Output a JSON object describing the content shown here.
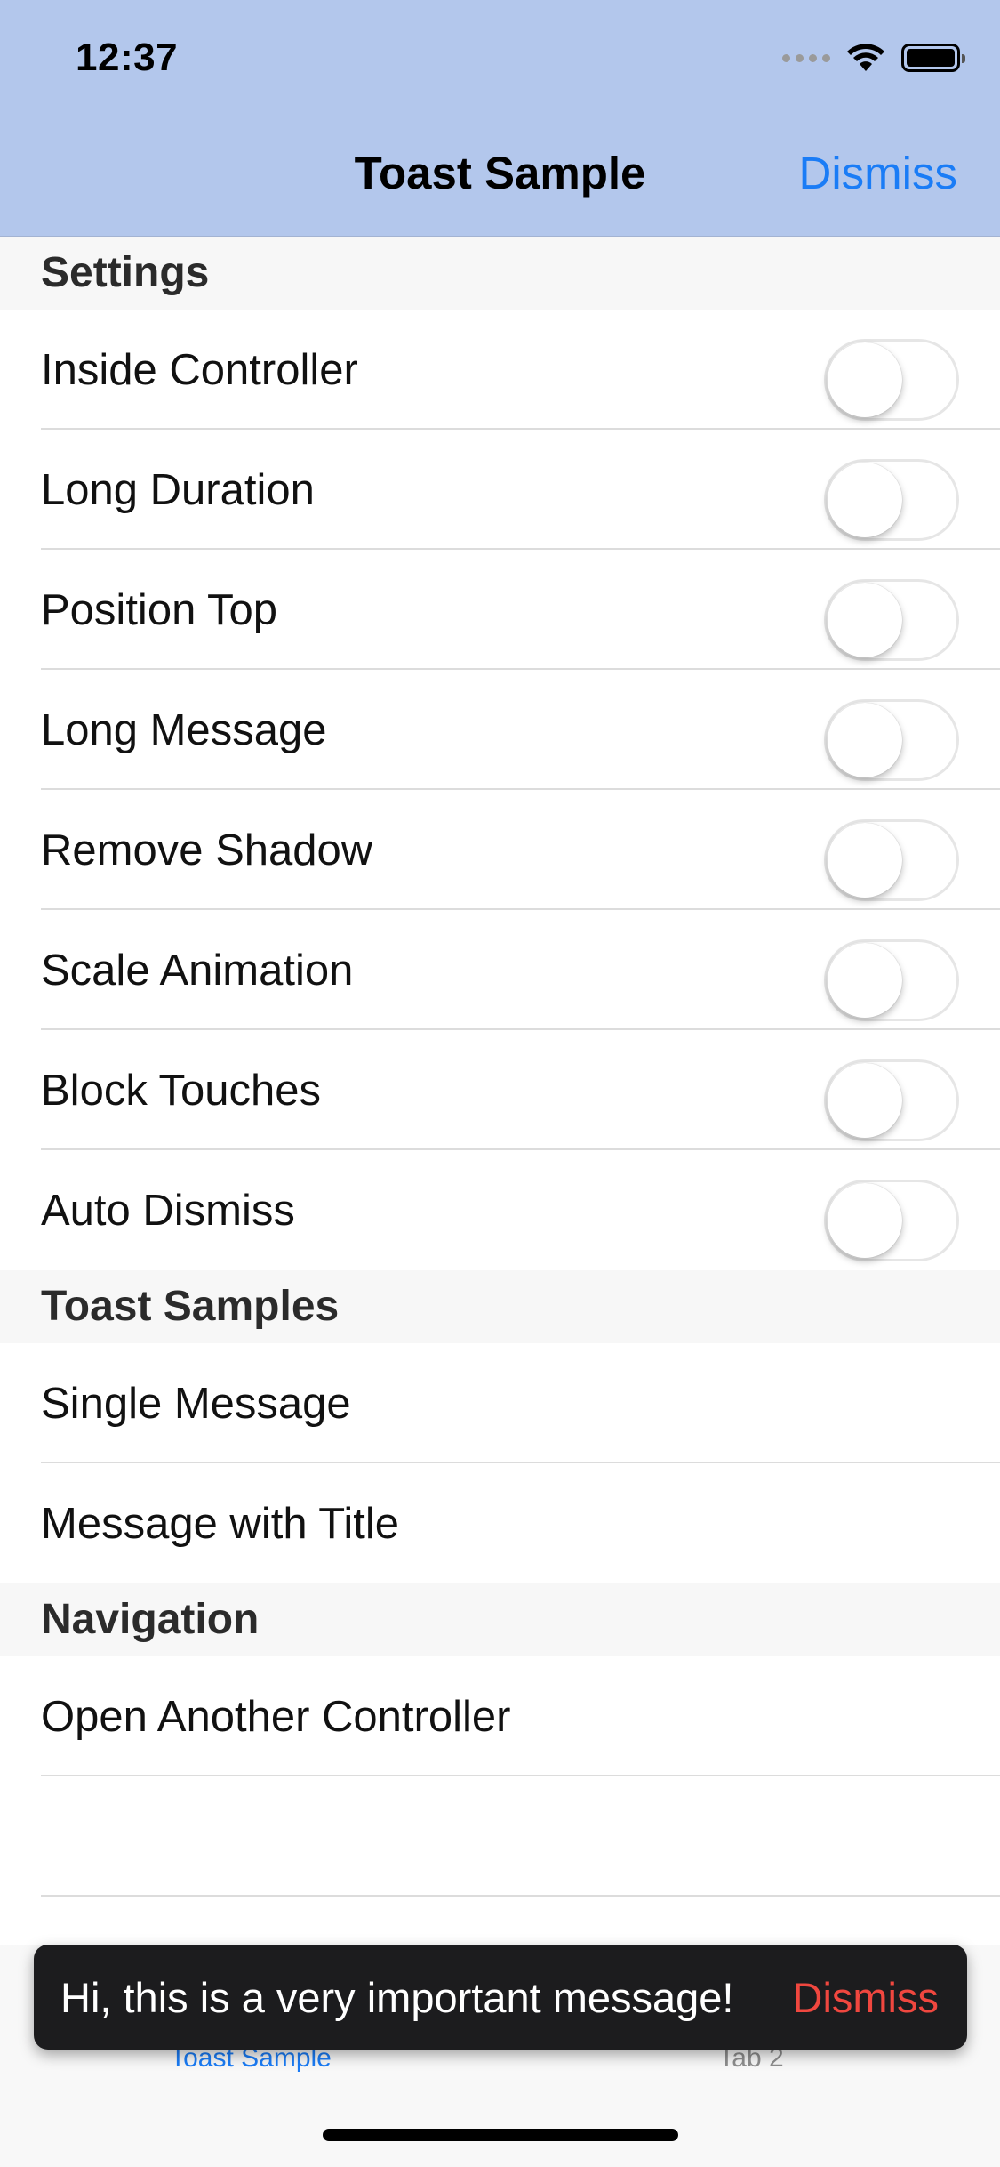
{
  "status_bar": {
    "time": "12:37"
  },
  "nav": {
    "title": "Toast Sample",
    "dismiss_label": "Dismiss"
  },
  "sections": {
    "settings": {
      "header": "Settings",
      "rows": [
        {
          "label": "Inside Controller",
          "toggle_on": false
        },
        {
          "label": "Long Duration",
          "toggle_on": false
        },
        {
          "label": "Position Top",
          "toggle_on": false
        },
        {
          "label": "Long Message",
          "toggle_on": false
        },
        {
          "label": "Remove Shadow",
          "toggle_on": false
        },
        {
          "label": "Scale Animation",
          "toggle_on": false
        },
        {
          "label": "Block Touches",
          "toggle_on": false
        },
        {
          "label": "Auto Dismiss",
          "toggle_on": false
        }
      ]
    },
    "toast_samples": {
      "header": "Toast Samples",
      "rows": [
        {
          "label": "Single Message"
        },
        {
          "label": "Message with Title"
        }
      ]
    },
    "navigation": {
      "header": "Navigation",
      "rows": [
        {
          "label": "Open Another Controller"
        }
      ]
    }
  },
  "toast": {
    "message": "Hi, this is a very important message!",
    "dismiss_label": "Dismiss"
  },
  "tabbar": {
    "tabs": [
      {
        "label": "Toast Sample"
      },
      {
        "label": "Tab 2"
      }
    ]
  },
  "colors": {
    "accent": "#1a7cf6",
    "nav_background": "#b3c7ec",
    "toast_dismiss": "#f0473f"
  },
  "icons": {
    "wifi": "wifi-icon",
    "battery": "battery-icon",
    "signal": "signal-icon"
  }
}
